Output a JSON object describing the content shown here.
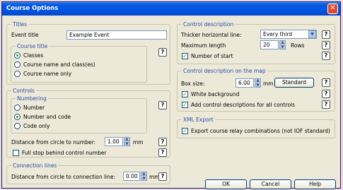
{
  "window": {
    "title": "Course Options",
    "close_glyph": "✕"
  },
  "titles": {
    "legend": "Titles",
    "event_title_label": "Event title",
    "event_title_value": "Example Event",
    "course_title": {
      "legend": "Course title",
      "options": [
        "Classes",
        "Course name and class(es)",
        "Course name only"
      ],
      "selected": 0
    }
  },
  "controls": {
    "legend": "Controls",
    "numbering": {
      "legend": "Numbering",
      "options": [
        "Number",
        "Number and code",
        "Code only"
      ],
      "selected": 1
    },
    "distance_label": "Distance from circle to number:",
    "distance_value": "1.00",
    "distance_unit": "mm",
    "full_stop_label": "Full stop behind control number",
    "full_stop_checked": false
  },
  "connection_lines": {
    "legend": "Connection lines",
    "distance_label": "Distance from circle to connection line:",
    "distance_value": "0.00",
    "distance_unit": "mm"
  },
  "control_description": {
    "legend": "Control description",
    "thicker_line_label": "Thicker horizontal line:",
    "thicker_line_value": "Every third",
    "max_length_label": "Maximum length",
    "max_length_value": "20",
    "max_length_unit": "Rows",
    "number_of_start_label": "Number of start",
    "number_of_start_checked": true
  },
  "description_on_map": {
    "legend": "Control description on the map",
    "box_size_label": "Box size:",
    "box_size_value": "6.00",
    "box_size_unit": "mm",
    "standard_button": "Standard",
    "white_background_label": "White background",
    "white_background_checked": true,
    "add_descriptions_label": "Add control descriptions for all controls",
    "add_descriptions_checked": true
  },
  "xml_export": {
    "legend": "XML Export",
    "relay_label": "Export course relay combinations (not IOF standard)",
    "relay_checked": true
  },
  "buttons": {
    "ok": "OK",
    "cancel": "Cancel",
    "help": "Help"
  },
  "help_glyph": "?",
  "checkmark": "✓",
  "spin_up": "▲",
  "spin_down": "▼",
  "dropdown_glyph": "▼"
}
